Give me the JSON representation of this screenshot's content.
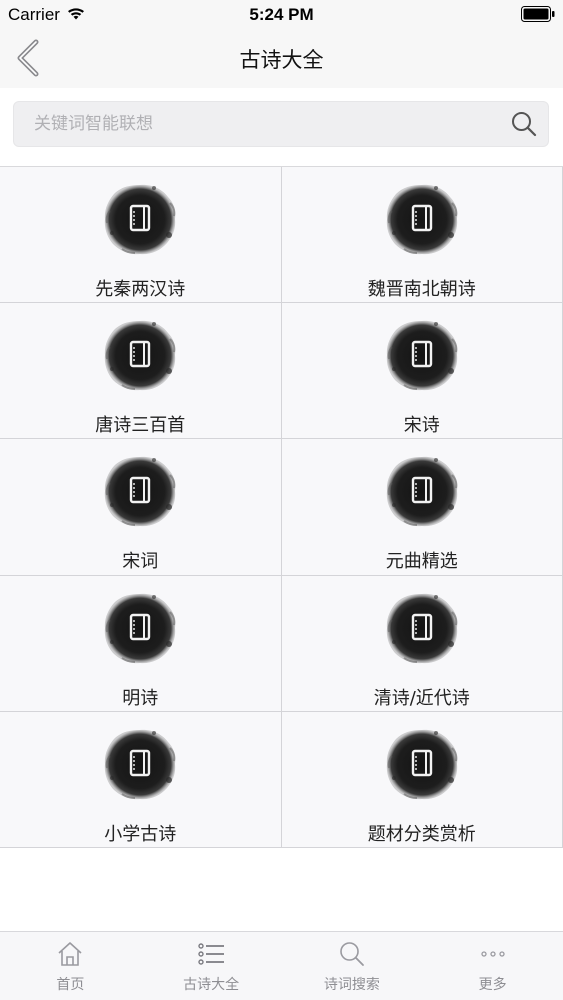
{
  "status_bar": {
    "carrier": "Carrier",
    "time": "5:24 PM"
  },
  "nav": {
    "title": "古诗大全",
    "back_icon": "chevron-left-icon"
  },
  "search": {
    "placeholder": "关键词智能联想",
    "value": "",
    "icon": "search-icon"
  },
  "categories": [
    {
      "label": "先秦两汉诗",
      "icon": "ink-notebook-icon"
    },
    {
      "label": "魏晋南北朝诗",
      "icon": "ink-notebook-icon"
    },
    {
      "label": "唐诗三百首",
      "icon": "ink-notebook-icon"
    },
    {
      "label": "宋诗",
      "icon": "ink-notebook-icon"
    },
    {
      "label": "宋词",
      "icon": "ink-notebook-icon"
    },
    {
      "label": "元曲精选",
      "icon": "ink-notebook-icon"
    },
    {
      "label": "明诗",
      "icon": "ink-notebook-icon"
    },
    {
      "label": "清诗/近代诗",
      "icon": "ink-notebook-icon"
    },
    {
      "label": "小学古诗",
      "icon": "ink-notebook-icon"
    },
    {
      "label": "题材分类赏析",
      "icon": "ink-notebook-icon"
    }
  ],
  "tabs": [
    {
      "label": "首页",
      "icon": "home-icon"
    },
    {
      "label": "古诗大全",
      "icon": "list-icon"
    },
    {
      "label": "诗词搜索",
      "icon": "search-icon"
    },
    {
      "label": "更多",
      "icon": "more-dots-icon"
    }
  ],
  "colors": {
    "background": "#ffffff",
    "bar_background": "#f7f7f7",
    "grid_cell": "#f8f8fa",
    "grid_line": "#d4d4d8",
    "text": "#222222",
    "tab_text": "#8e8e93",
    "icon_ink": "#1a1a1a"
  }
}
